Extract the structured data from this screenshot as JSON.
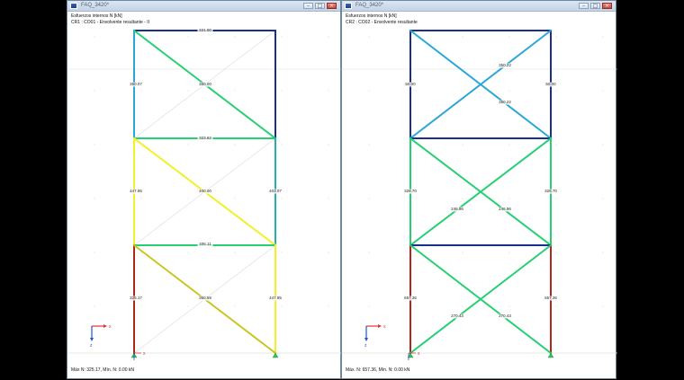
{
  "colors": {
    "desktop": "#000000",
    "window_border": "#6f879f",
    "grid_line": "#d6e5d6",
    "dot": "#c8c8c8",
    "ghost": "#c8c8c8",
    "dark_blue": "#1a2e8c",
    "light_blue": "#2aa6d8",
    "teal": "#22b0a8",
    "green": "#27cf73",
    "yellow": "#f2f02a",
    "olive_yellow": "#c9c622",
    "dark_red": "#b2241c",
    "support": "#36c05a",
    "axis_x": "#d43a3a",
    "axis_y": "#2256c8"
  },
  "windows": [
    {
      "id": "left",
      "title": "FAQ_3420*",
      "info_line1": "Esfuerzos internos N [kN]",
      "info_line2": "CR1 : CO01 - Envolvente resultante - II",
      "status": "Máx N: 325.17, Mín. N: 0.00 kN",
      "controls": [
        "–",
        "□",
        "×"
      ],
      "labels": [
        "221.00",
        "350.07",
        "350.00",
        "323.62",
        "447.95",
        "400.00",
        "403.07",
        "406.11",
        "325.17",
        "350.59",
        "447.95"
      ],
      "axis_labels": {
        "x": "x",
        "y": "y",
        "z": "z"
      }
    },
    {
      "id": "right",
      "title": "FAQ_3420*",
      "info_line1": "Esfuerzos internos N [kN]",
      "info_line2": "CR2 : CO02 - Envolvente resultante",
      "status": "Máx. N: 657.36, Mín. N: 0.00 kN",
      "controls": [
        "–",
        "□",
        "×"
      ],
      "labels": [
        "50.00",
        "50.00",
        "350.22",
        "350.22",
        "328.70",
        "328.70",
        "246.96",
        "246.96",
        "657.36",
        "657.36",
        "270.43",
        "270.43"
      ],
      "axis_labels": {
        "x": "x",
        "y": "y",
        "z": "z"
      }
    }
  ]
}
